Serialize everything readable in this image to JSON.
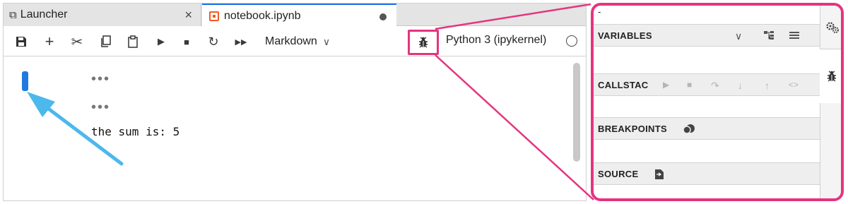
{
  "tabs": {
    "launcher_label": "Launcher",
    "launcher_close": "×",
    "notebook_label": "notebook.ipynb"
  },
  "toolbar": {
    "cell_type": "Markdown",
    "kernel_name": "Python 3 (ipykernel)"
  },
  "notebook": {
    "ellipsis1": "•••",
    "ellipsis2": "•••",
    "output_text": "the sum is: 5"
  },
  "debugger": {
    "top_text": "-",
    "variables_title": "VARIABLES",
    "callstack_title": "CALLSTAC",
    "breakpoints_title": "BREAKPOINTS",
    "source_title": "SOURCE"
  },
  "colors": {
    "highlight": "#e5347f",
    "arrow": "#4cb8ec",
    "cell_marker": "#1f7ae0",
    "active_tab_border": "#1a73e8",
    "notebook_icon": "#f15a24"
  }
}
